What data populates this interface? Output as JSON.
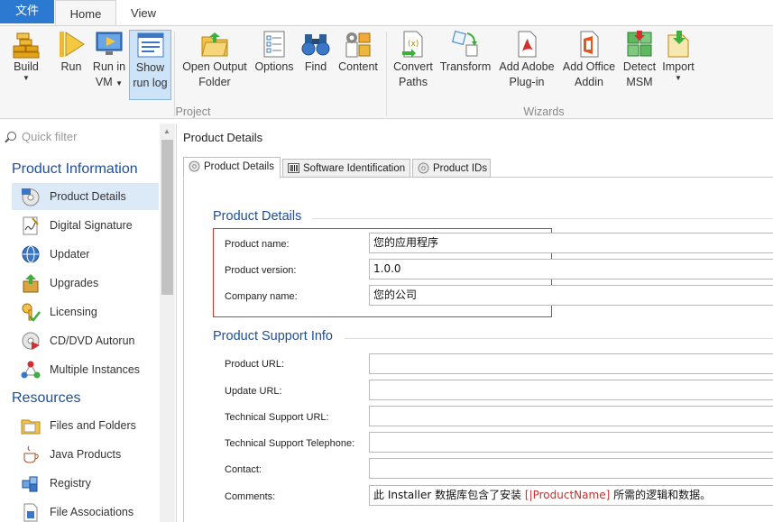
{
  "tabs": {
    "file": "文件",
    "home": "Home",
    "view": "View"
  },
  "ribbon": {
    "buttons": {
      "build": "Build",
      "run": "Run",
      "run_in_vm_1": "Run in",
      "run_in_vm_2": "VM",
      "show_log_1": "Show",
      "show_log_2": "run log",
      "open_output_1": "Open Output",
      "open_output_2": "Folder",
      "options": "Options",
      "find": "Find",
      "content": "Content",
      "convert_1": "Convert",
      "convert_2": "Paths",
      "transform": "Transform",
      "adobe_1": "Add Adobe",
      "adobe_2": "Plug-in",
      "office_1": "Add Office",
      "office_2": "Addin",
      "detect_1": "Detect",
      "detect_2": "MSM",
      "import": "Import"
    },
    "groups": {
      "project": "Project",
      "wizards": "Wizards"
    }
  },
  "sidebar": {
    "filter_placeholder": "Quick filter",
    "sections": {
      "product_information": "Product Information",
      "resources": "Resources"
    },
    "items": [
      {
        "label": "Product Details",
        "icon": "product-details-icon"
      },
      {
        "label": "Digital Signature",
        "icon": "signature-icon"
      },
      {
        "label": "Updater",
        "icon": "updater-icon"
      },
      {
        "label": "Upgrades",
        "icon": "upgrades-icon"
      },
      {
        "label": "Licensing",
        "icon": "licensing-icon"
      },
      {
        "label": "CD/DVD Autorun",
        "icon": "autorun-icon"
      },
      {
        "label": "Multiple Instances",
        "icon": "instances-icon"
      },
      {
        "label": "Files and Folders",
        "icon": "folder-icon"
      },
      {
        "label": "Java Products",
        "icon": "java-icon"
      },
      {
        "label": "Registry",
        "icon": "registry-icon"
      },
      {
        "label": "File Associations",
        "icon": "file-associations-icon"
      }
    ]
  },
  "main": {
    "title": "Product Details",
    "subtabs": [
      "Product Details",
      "Software Identification",
      "Product IDs"
    ],
    "groups": {
      "details": "Product Details",
      "support": "Product Support Info"
    },
    "fields": {
      "product_name": {
        "label": "Product name:",
        "value": "您的应用程序"
      },
      "product_version": {
        "label": "Product version:",
        "value": "1.0.0"
      },
      "company_name": {
        "label": "Company name:",
        "value": "您的公司"
      },
      "product_url": {
        "label": "Product URL:",
        "value": ""
      },
      "update_url": {
        "label": "Update URL:",
        "value": ""
      },
      "support_url": {
        "label": "Technical Support URL:",
        "value": ""
      },
      "support_phone": {
        "label": "Technical Support Telephone:",
        "value": ""
      },
      "contact": {
        "label": "Contact:",
        "value": ""
      },
      "comments": {
        "label": "Comments:",
        "value_before": "此 Installer 数据库包含了安装 ",
        "value_prop": "[|ProductName]",
        "value_after": " 所需的逻辑和数据。"
      }
    }
  },
  "colors": {
    "accent": "#2b79d0",
    "section_text": "#1f4e9a",
    "highlight_box": "#e03434",
    "selected_bg": "#dce9f7"
  }
}
